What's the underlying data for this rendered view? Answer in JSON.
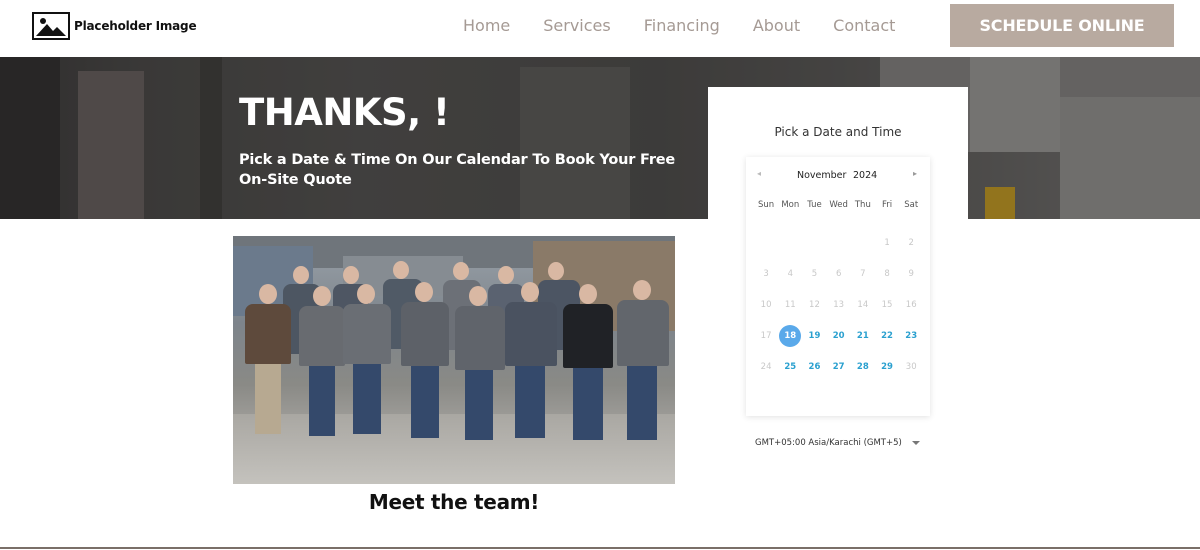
{
  "header": {
    "logo_text": "Placeholder Image",
    "logo_icon": "image-placeholder-icon",
    "nav": [
      "Home",
      "Services",
      "Financing",
      "About",
      "Contact"
    ],
    "cta_label": "SCHEDULE ONLINE"
  },
  "hero": {
    "title": "THANKS, !",
    "subtitle": "Pick a Date & Time On Our Calendar To Book Your Free On-Site Quote"
  },
  "team": {
    "caption": "Meet the team!"
  },
  "calendar": {
    "title": "Pick a Date and Time",
    "month": "November",
    "year": "2024",
    "prev_icon": "chevron-left-icon",
    "next_icon": "chevron-right-icon",
    "weekdays": [
      "Sun",
      "Mon",
      "Tue",
      "Wed",
      "Thu",
      "Fri",
      "Sat"
    ],
    "weeks": [
      [
        "",
        "",
        "",
        "",
        "",
        "1",
        "2"
      ],
      [
        "3",
        "4",
        "5",
        "6",
        "7",
        "8",
        "9"
      ],
      [
        "10",
        "11",
        "12",
        "13",
        "14",
        "15",
        "16"
      ],
      [
        "17",
        "18",
        "19",
        "20",
        "21",
        "22",
        "23"
      ],
      [
        "24",
        "25",
        "26",
        "27",
        "28",
        "29",
        "30"
      ]
    ],
    "available_days": [
      "18",
      "19",
      "20",
      "21",
      "22",
      "23",
      "25",
      "26",
      "27",
      "28",
      "29"
    ],
    "selected_day": "18",
    "timezone": "GMT+05:00 Asia/Karachi (GMT+5)"
  },
  "colors": {
    "cta_bg": "#b8aaa0",
    "nav_text": "#a59a94",
    "available_day": "#2aa0cf",
    "selected_day_bg": "#5aa9ea"
  }
}
